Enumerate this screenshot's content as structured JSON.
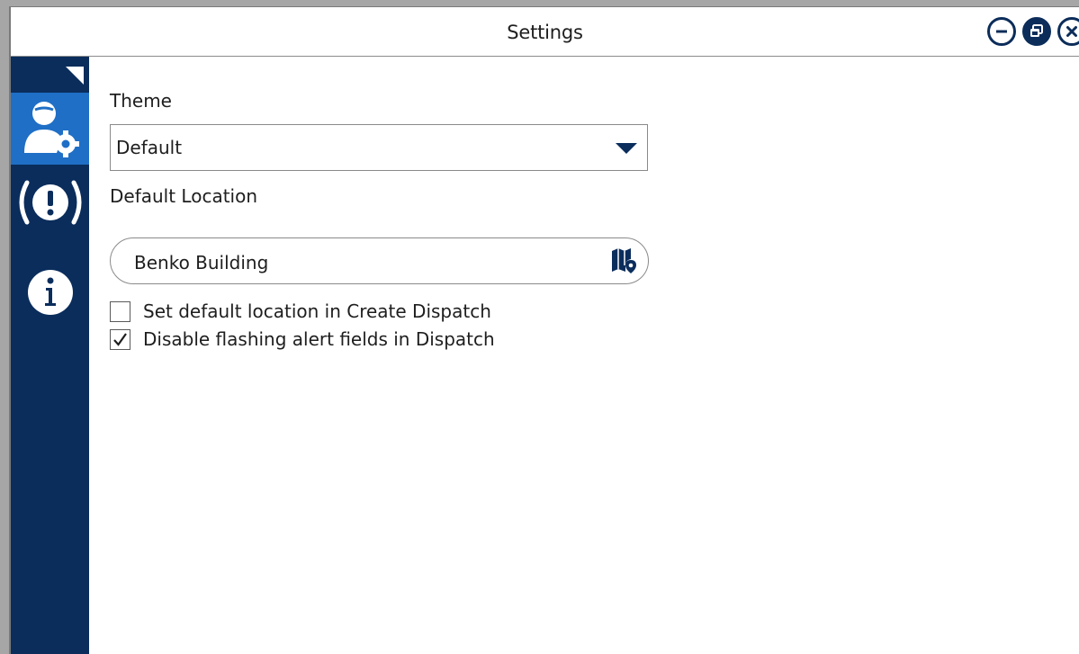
{
  "window": {
    "title": "Settings",
    "controls": {
      "minimize": "minimize-icon",
      "restore": "restore-icon",
      "close": "close-icon"
    }
  },
  "sidebar": {
    "items": [
      {
        "id": "user-settings",
        "icon": "user-settings-icon",
        "active": true
      },
      {
        "id": "alerts",
        "icon": "alert-icon",
        "active": false
      },
      {
        "id": "info",
        "icon": "info-icon",
        "active": false
      }
    ]
  },
  "settings": {
    "theme_label": "Theme",
    "theme_value": "Default",
    "location_label": "Default Location",
    "location_value": "Benko Building",
    "checkboxes": [
      {
        "label": "Set default location in Create Dispatch",
        "checked": false
      },
      {
        "label": "Disable flashing alert fields in Dispatch",
        "checked": true
      }
    ]
  },
  "colors": {
    "sidebar": "#0a2d5c",
    "active_nav": "#1f6fc6",
    "accent": "#0c2d5a"
  }
}
